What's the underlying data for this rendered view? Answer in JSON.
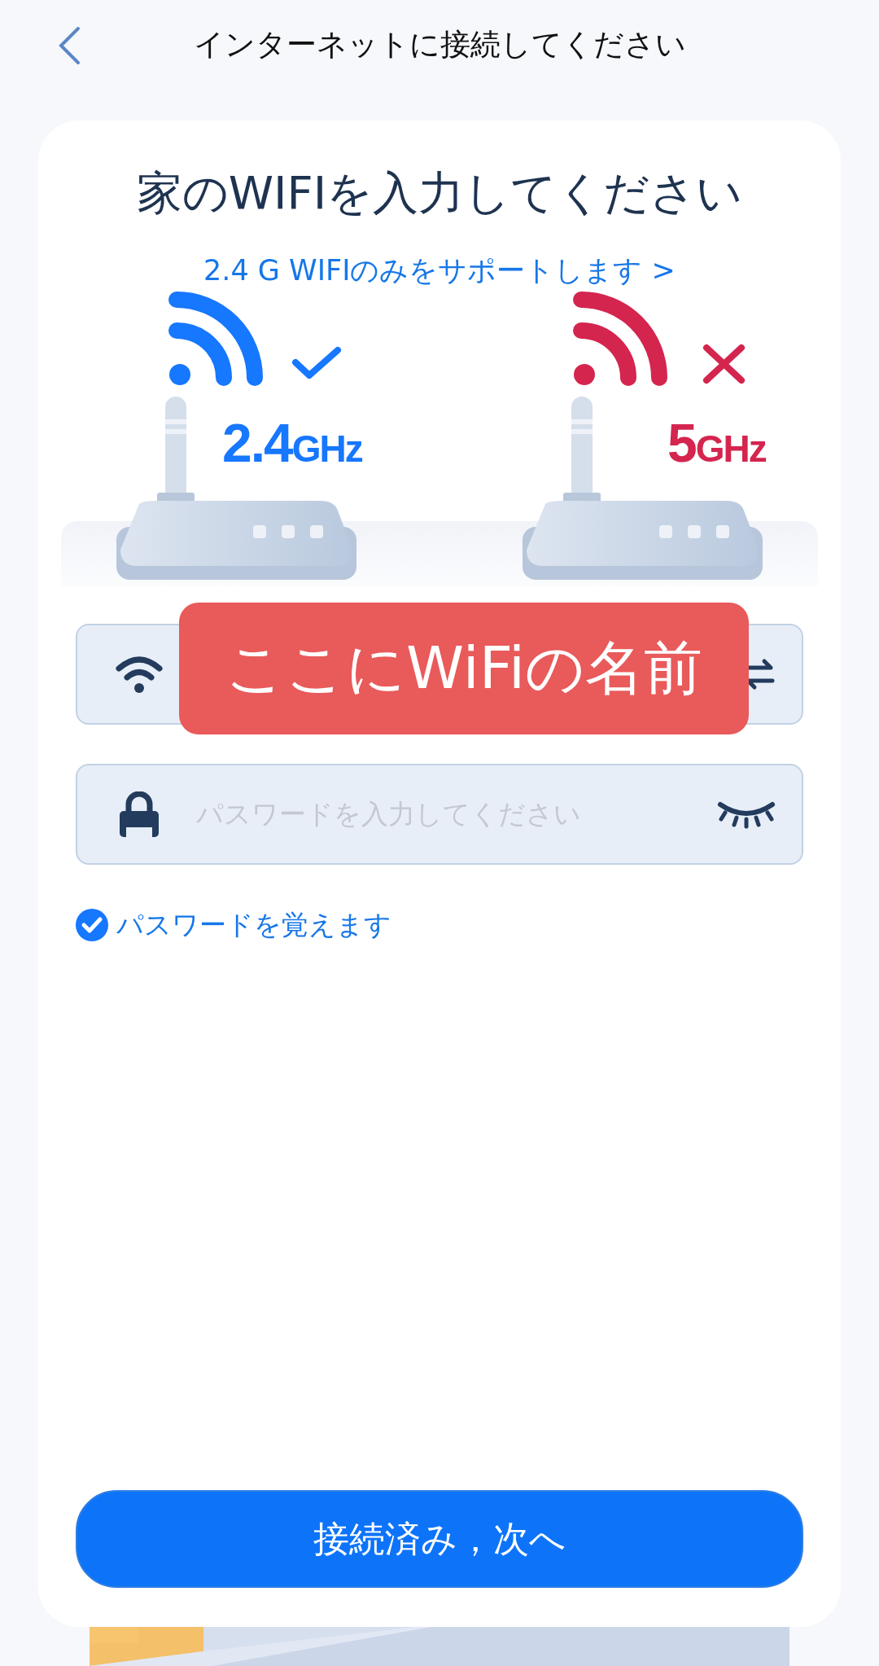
{
  "header": {
    "title": "インターネットに接続してください"
  },
  "card": {
    "heading": "家のWIFIを入力してください",
    "link": "2.4 G WIFIのみをサポートします >",
    "bands": [
      {
        "kind": "supported",
        "label": "2.4",
        "unit": "GHz",
        "color": "#1677ff"
      },
      {
        "kind": "unsupported",
        "label": "5",
        "unit": "GHz",
        "color": "#d4254e"
      }
    ],
    "fields": [
      {
        "kind": "wifi"
      },
      {
        "kind": "password",
        "placeholder": "パスワードを入力してください"
      }
    ],
    "overlay_label": "ここにWiFiの名前",
    "remember": {
      "label": "パスワードを覚えます",
      "checked": true
    },
    "button": "接続済み，次へ"
  }
}
